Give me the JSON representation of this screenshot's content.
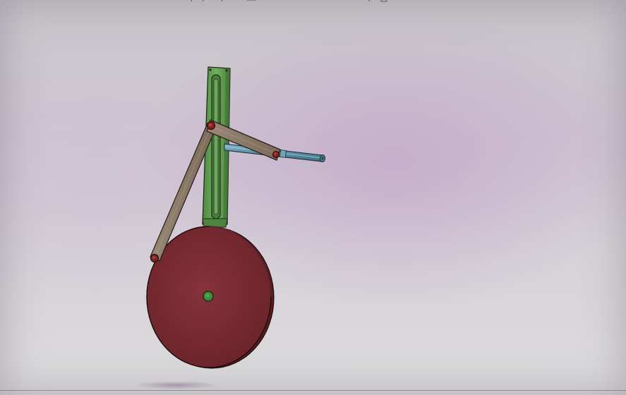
{
  "viewport": {
    "background_top": "#c9c7cc",
    "background_mid": "#cfc6d2",
    "background_bottom": "#dcdbdc"
  },
  "model": {
    "parts": [
      {
        "name": "slotted-guide",
        "color": "#5f9c4f"
      },
      {
        "name": "crank-disc",
        "color": "#7a2e33"
      },
      {
        "name": "connecting-link",
        "color": "#8c7a68"
      },
      {
        "name": "rocker-arm",
        "color": "#8c7a68"
      },
      {
        "name": "slider-rod",
        "color": "#5b8fa6"
      },
      {
        "name": "pin-joint",
        "color": "#8a1f1f"
      },
      {
        "name": "disc-axle",
        "color": "#3f8a3a"
      }
    ]
  }
}
